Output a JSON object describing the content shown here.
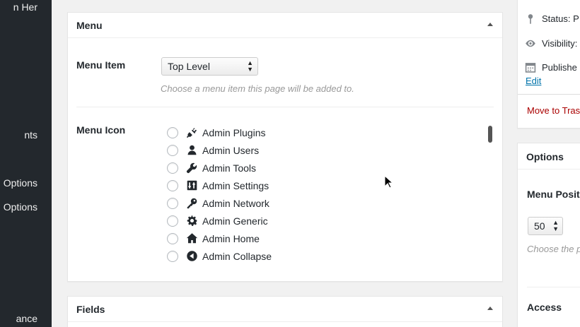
{
  "sidebar": {
    "items": [
      {
        "label": "n Her"
      },
      {
        "label": "nts"
      },
      {
        "label": "Options"
      },
      {
        "label": "Options"
      },
      {
        "label": "ance"
      }
    ]
  },
  "menu_box": {
    "title": "Menu",
    "menu_item_label": "Menu Item",
    "menu_item_value": "Top Level",
    "menu_item_hint": "Choose a menu item this page will be added to.",
    "menu_icon_label": "Menu Icon",
    "icons": [
      {
        "label": "Admin Plugins",
        "icon": "plugins-icon"
      },
      {
        "label": "Admin Users",
        "icon": "users-icon"
      },
      {
        "label": "Admin Tools",
        "icon": "wrench-icon"
      },
      {
        "label": "Admin Settings",
        "icon": "settings-icon"
      },
      {
        "label": "Admin Network",
        "icon": "key-icon"
      },
      {
        "label": "Admin Generic",
        "icon": "gear-icon"
      },
      {
        "label": "Admin Home",
        "icon": "home-icon"
      },
      {
        "label": "Admin Collapse",
        "icon": "collapse-icon"
      }
    ]
  },
  "fields_box": {
    "title": "Fields"
  },
  "publish_box": {
    "status_text": "Status: P",
    "visibility_text": "Visibility:",
    "published_text": "Publishe",
    "edit_link": "Edit",
    "trash_link": "Move to Tras"
  },
  "options_box": {
    "title": "Options",
    "menu_position_label": "Menu Posit",
    "menu_position_value": "50",
    "menu_position_hint": "Choose the p",
    "access_label": "Access"
  },
  "colors": {
    "sidebar_bg": "#23282d",
    "link": "#0073aa",
    "delete": "#a00"
  }
}
